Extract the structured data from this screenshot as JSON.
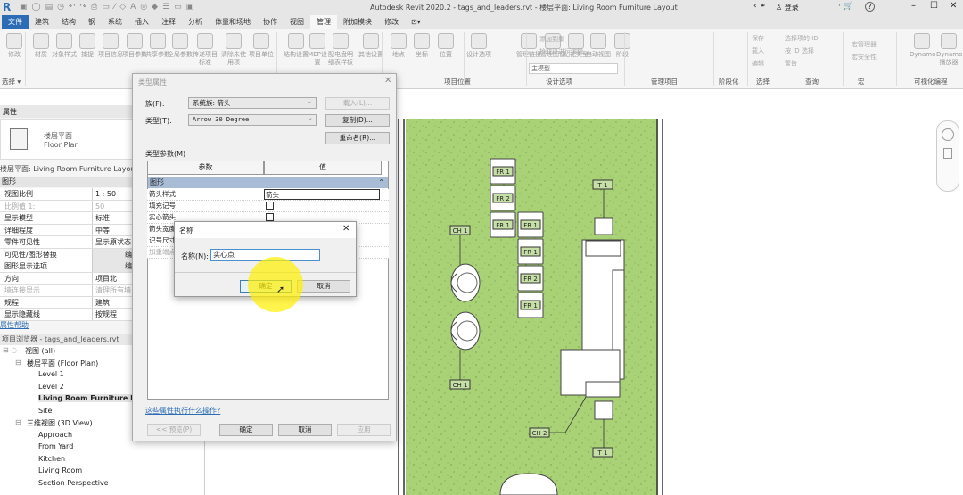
{
  "window": {
    "title": "Autodesk Revit 2020.2 - tags_and_leaders.rvt - 楼层平面: Living Room Furniture Layout",
    "signin": "登录",
    "help": "?"
  },
  "tabs": [
    {
      "label": "文件"
    },
    {
      "label": "建筑"
    },
    {
      "label": "结构"
    },
    {
      "label": "钢"
    },
    {
      "label": "系统"
    },
    {
      "label": "插入"
    },
    {
      "label": "注释"
    },
    {
      "label": "分析"
    },
    {
      "label": "体量和场地"
    },
    {
      "label": "协作"
    },
    {
      "label": "视图"
    },
    {
      "label": "管理"
    },
    {
      "label": "附加模块"
    },
    {
      "label": "修改"
    },
    {
      "label": "⊡▾"
    }
  ],
  "ribbon": {
    "buttons": [
      "修改",
      "材质",
      "对象样式",
      "捕捉",
      "项目信息",
      "项目参数",
      "共享参数",
      "全局参数",
      "传递项目标准",
      "清除未使用项",
      "项目单位",
      "结构设置",
      "MEP设置",
      "配电盘明细表样板",
      "其他设置",
      "地点",
      "坐标",
      "位置",
      "设计选项",
      "管理链接",
      "管理图像",
      "贴花类型",
      "启动视图",
      "阶段",
      "Dynamo",
      "Dynamo 播放器"
    ],
    "small": [
      "添加到集",
      "拾取以进行编辑",
      "主模型",
      "保存",
      "载入",
      "编辑",
      "选择项的 ID",
      "按 ID 选择",
      "警告",
      "宏管理器",
      "宏安全性"
    ],
    "panels": [
      "选择 ▾",
      "项目位置",
      "设计选项",
      "管理项目",
      "阶段化",
      "选择",
      "查询",
      "宏",
      "可视化编程"
    ]
  },
  "properties": {
    "title": "属性",
    "type_cn": "楼层平面",
    "type_en": "Floor Plan",
    "instance": "楼层平面: Living Room Furniture Layout",
    "group": "图形",
    "rows": [
      {
        "k": "视图比例",
        "v": "1 : 50"
      },
      {
        "k": "比例值 1:",
        "v": "50"
      },
      {
        "k": "显示模型",
        "v": "标准"
      },
      {
        "k": "详细程度",
        "v": "中等"
      },
      {
        "k": "零件可见性",
        "v": "显示原状态"
      },
      {
        "k": "可见性/图形替换",
        "v": "编"
      },
      {
        "k": "图形显示选项",
        "v": "编"
      },
      {
        "k": "方向",
        "v": "项目北"
      },
      {
        "k": "墙连接显示",
        "v": "清理所有墙"
      },
      {
        "k": "规程",
        "v": "建筑"
      },
      {
        "k": "显示隐藏线",
        "v": "按规程"
      }
    ],
    "help": "属性帮助"
  },
  "browser": {
    "title": "项目浏览器 - tags_and_leaders.rvt",
    "items": [
      {
        "t": "视图 (all)",
        "l": 0
      },
      {
        "t": "楼层平面 (Floor Plan)",
        "l": 1
      },
      {
        "t": "Level 1",
        "l": 2
      },
      {
        "t": "Level 2",
        "l": 2
      },
      {
        "t": "Living Room Furniture Layout",
        "l": 2,
        "b": true
      },
      {
        "t": "Site",
        "l": 2
      },
      {
        "t": "三维视图 (3D View)",
        "l": 1
      },
      {
        "t": "Approach",
        "l": 2
      },
      {
        "t": "From Yard",
        "l": 2
      },
      {
        "t": "Kitchen",
        "l": 2
      },
      {
        "t": "Living Room",
        "l": 2
      },
      {
        "t": "Section Perspective",
        "l": 2
      }
    ]
  },
  "type_dialog": {
    "title": "类型属性",
    "family_label": "族(F):",
    "family": "系统族: 箭头",
    "type_label": "类型(T):",
    "type": "Arrow 30 Degree",
    "load": "载入(L)...",
    "duplicate": "复制(D)...",
    "rename": "重命名(R)...",
    "params_label": "类型参数(M)",
    "col_param": "参数",
    "col_value": "值",
    "group": "图形",
    "rows": [
      {
        "k": "箭头样式",
        "v": "箭头"
      },
      {
        "k": "填充记号",
        "v": ""
      },
      {
        "k": "实心箭头",
        "v": ""
      },
      {
        "k": "箭头宽度角",
        "v": ""
      },
      {
        "k": "记号尺寸",
        "v": ""
      },
      {
        "k": "加重端点笔宽",
        "v": ""
      }
    ],
    "link": "这些属性执行什么操作?",
    "preview": "<< 预览(P)",
    "ok": "确定",
    "cancel": "取消",
    "apply": "应用"
  },
  "name_dialog": {
    "title": "名称",
    "label": "名称(N):",
    "value": "实心点",
    "ok": "确定",
    "cancel": "取消"
  },
  "plan": {
    "tags": [
      "FR 1",
      "FR 2",
      "FR 1",
      "FR 1",
      "FR 1",
      "FR 2",
      "FR 1",
      "T 1",
      "T 1",
      "CH 1",
      "CH 1",
      "CH 2"
    ],
    "floor_color": "#a9d176"
  }
}
